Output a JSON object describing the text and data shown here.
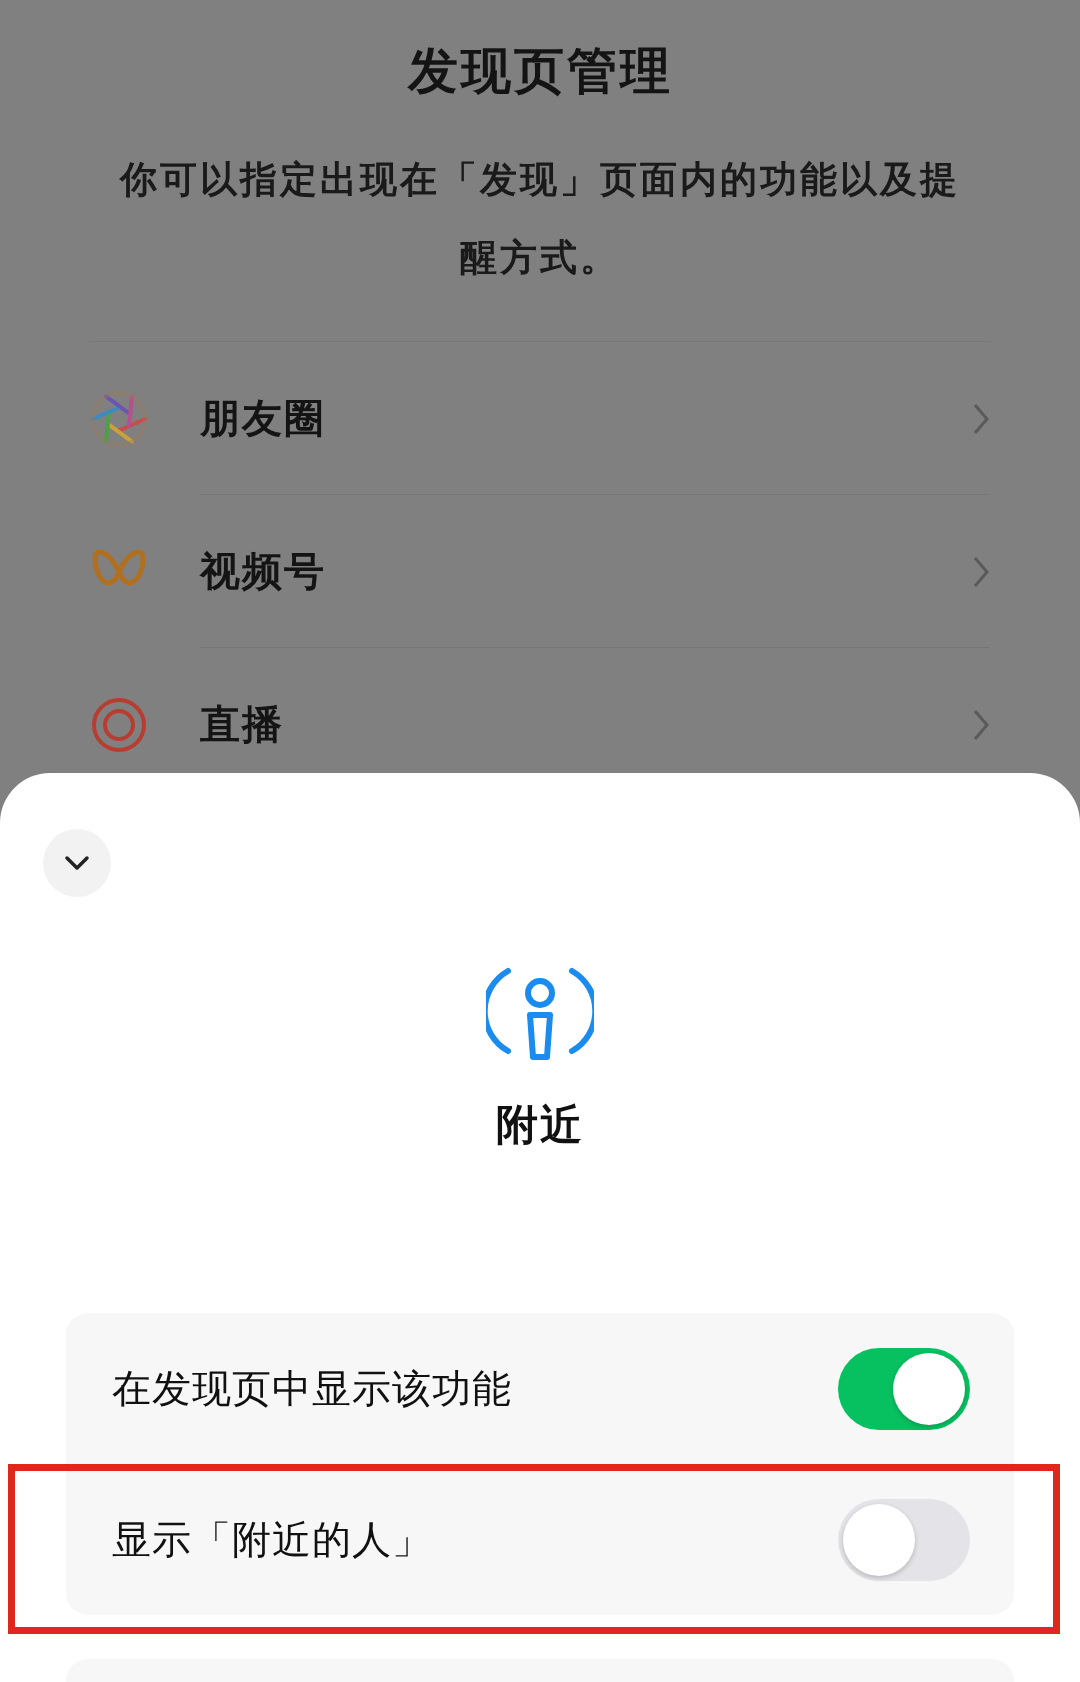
{
  "header": {
    "title": "发现页管理",
    "description": "你可以指定出现在「发现」页面内的功能以及提醒方式。"
  },
  "features": [
    {
      "label": "朋友圈",
      "kind": "moments"
    },
    {
      "label": "视频号",
      "kind": "channels"
    },
    {
      "label": "直播",
      "kind": "live"
    }
  ],
  "sheet": {
    "title": "附近",
    "settings": [
      {
        "label": "在发现页中显示该功能",
        "on": true,
        "highlighted": false
      },
      {
        "label": "显示「附近的人」",
        "on": false,
        "highlighted": true
      }
    ]
  }
}
